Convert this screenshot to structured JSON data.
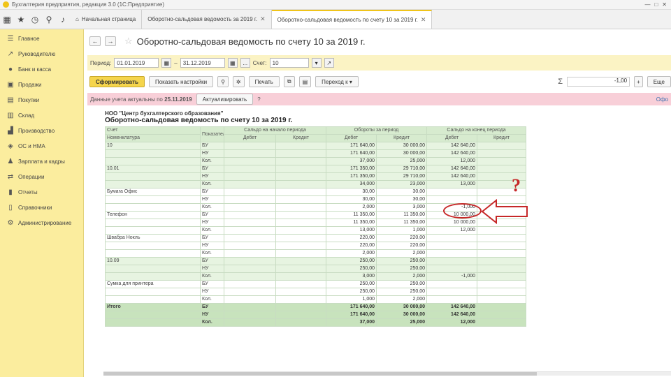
{
  "window": {
    "title": "Бухгалтерия предприятия, редакция 3.0 (1С:Предприятие)"
  },
  "tabs": [
    {
      "label": "Начальная страница"
    },
    {
      "label": "Оборотно-сальдовая ведомость за 2019 г."
    },
    {
      "label": "Оборотно-сальдовая ведомость по счету 10 за 2019 г."
    }
  ],
  "sidebar": {
    "items": [
      {
        "label": "Главное",
        "icon": "list-icon"
      },
      {
        "label": "Руководителю",
        "icon": "chart-icon"
      },
      {
        "label": "Банк и касса",
        "icon": "bank-icon"
      },
      {
        "label": "Продажи",
        "icon": "sales-icon"
      },
      {
        "label": "Покупки",
        "icon": "cart-icon"
      },
      {
        "label": "Склад",
        "icon": "warehouse-icon"
      },
      {
        "label": "Производство",
        "icon": "factory-icon"
      },
      {
        "label": "ОС и НМА",
        "icon": "assets-icon"
      },
      {
        "label": "Зарплата и кадры",
        "icon": "people-icon"
      },
      {
        "label": "Операции",
        "icon": "operations-icon"
      },
      {
        "label": "Отчеты",
        "icon": "reports-icon"
      },
      {
        "label": "Справочники",
        "icon": "book-icon"
      },
      {
        "label": "Администрирование",
        "icon": "gear-icon"
      }
    ]
  },
  "header": {
    "title": "Оборотно-сальдовая ведомость по счету 10 за 2019 г."
  },
  "filter": {
    "period_label": "Период:",
    "date_from": "01.01.2019",
    "date_to": "31.12.2019",
    "dash": "–",
    "dots": "...",
    "account_label": "Счет:",
    "account": "10"
  },
  "toolbar": {
    "generate": "Сформировать",
    "show_settings": "Показать настройки",
    "print": "Печать",
    "more": "Ещё",
    "sum_symbol": "Σ",
    "sum_value": "-1,00",
    "save_as": "Еще",
    "hyperlinks": "Переход к"
  },
  "notice": {
    "text": "Данные учета актуальны по",
    "date": "25.11.2019",
    "button": "Актуализировать",
    "hint": "?",
    "right": "Офо"
  },
  "report": {
    "org": "НОО \"Центр бухгалтерского образования\"",
    "title": "Оборотно-сальдовая ведомость по счету 10 за 2019 г.",
    "headers": {
      "account": "Счет",
      "nomenclature": "Номенклатура",
      "indicators": "Показатели",
      "opening": "Сальдо на начало периода",
      "turnover": "Обороты за период",
      "closing": "Сальдо на конец периода",
      "debit": "Дебет",
      "credit": "Кредит"
    },
    "rows": [
      {
        "name": "10",
        "ind": "БУ",
        "turn_dt": "171 640,00",
        "turn_ct": "30 000,00",
        "end_dt": "142 640,00",
        "group": true
      },
      {
        "name": "",
        "ind": "НУ",
        "turn_dt": "171 640,00",
        "turn_ct": "30 000,00",
        "end_dt": "142 640,00",
        "group": true
      },
      {
        "name": "",
        "ind": "Кол.",
        "turn_dt": "37,000",
        "turn_ct": "25,000",
        "end_dt": "12,000",
        "group": true
      },
      {
        "name": "10.01",
        "ind": "БУ",
        "turn_dt": "171 350,00",
        "turn_ct": "29 710,00",
        "end_dt": "142 640,00",
        "group": true
      },
      {
        "name": "",
        "ind": "НУ",
        "turn_dt": "171 350,00",
        "turn_ct": "29 710,00",
        "end_dt": "142 640,00",
        "group": true
      },
      {
        "name": "",
        "ind": "Кол.",
        "turn_dt": "34,000",
        "turn_ct": "23,000",
        "end_dt": "13,000",
        "group": true
      },
      {
        "name": "Бумага Офис",
        "ind": "БУ",
        "turn_dt": "30,00",
        "turn_ct": "30,00",
        "end_dt": ""
      },
      {
        "name": "",
        "ind": "НУ",
        "turn_dt": "30,00",
        "turn_ct": "30,00",
        "end_dt": ""
      },
      {
        "name": "",
        "ind": "Кол.",
        "turn_dt": "2,000",
        "turn_ct": "3,000",
        "end_dt": "-1,000"
      },
      {
        "name": "Телефон",
        "ind": "БУ",
        "turn_dt": "11 350,00",
        "turn_ct": "11 350,00",
        "end_dt": "10 000,00"
      },
      {
        "name": "",
        "ind": "НУ",
        "turn_dt": "11 350,00",
        "turn_ct": "11 350,00",
        "end_dt": "10 000,00"
      },
      {
        "name": "",
        "ind": "Кол.",
        "turn_dt": "13,000",
        "turn_ct": "1,000",
        "end_dt": "12,000"
      },
      {
        "name": "Швабра Нокль",
        "ind": "БУ",
        "turn_dt": "220,00",
        "turn_ct": "220,00",
        "end_dt": ""
      },
      {
        "name": "",
        "ind": "НУ",
        "turn_dt": "220,00",
        "turn_ct": "220,00",
        "end_dt": ""
      },
      {
        "name": "",
        "ind": "Кол.",
        "turn_dt": "2,000",
        "turn_ct": "2,000",
        "end_dt": ""
      },
      {
        "name": "10.09",
        "ind": "БУ",
        "turn_dt": "250,00",
        "turn_ct": "250,00",
        "end_dt": "",
        "group": true
      },
      {
        "name": "",
        "ind": "НУ",
        "turn_dt": "250,00",
        "turn_ct": "250,00",
        "end_dt": "",
        "group": true
      },
      {
        "name": "",
        "ind": "Кол.",
        "turn_dt": "3,000",
        "turn_ct": "2,000",
        "end_dt": "-1,000",
        "group": true
      },
      {
        "name": "Сумка для принтера",
        "ind": "БУ",
        "turn_dt": "250,00",
        "turn_ct": "250,00",
        "end_dt": ""
      },
      {
        "name": "",
        "ind": "НУ",
        "turn_dt": "250,00",
        "turn_ct": "250,00",
        "end_dt": ""
      },
      {
        "name": "",
        "ind": "Кол.",
        "turn_dt": "1,000",
        "turn_ct": "2,000",
        "end_dt": ""
      },
      {
        "name": "Итого",
        "ind": "БУ",
        "turn_dt": "171 640,00",
        "turn_ct": "30 000,00",
        "end_dt": "142 640,00",
        "total": true
      },
      {
        "name": "",
        "ind": "НУ",
        "turn_dt": "171 640,00",
        "turn_ct": "30 000,00",
        "end_dt": "142 640,00",
        "total": true
      },
      {
        "name": "",
        "ind": "Кол.",
        "turn_dt": "37,000",
        "turn_ct": "25,000",
        "end_dt": "12,000",
        "total": true
      }
    ]
  },
  "annotation": {
    "question": "?"
  }
}
